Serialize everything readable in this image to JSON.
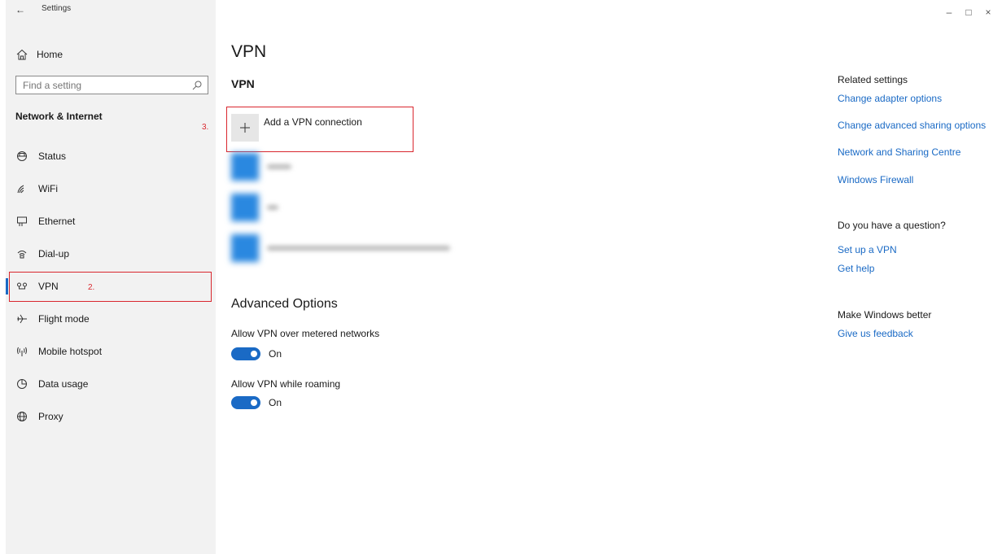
{
  "window": {
    "back_glyph": "←",
    "title": "Settings",
    "minimize_glyph": "–",
    "restore_glyph": "□",
    "close_glyph": "×"
  },
  "sidebar": {
    "home_label": "Home",
    "search_placeholder": "Find a setting",
    "section_title": "Network & Internet",
    "items": [
      {
        "label": "Status",
        "icon": "status-icon"
      },
      {
        "label": "WiFi",
        "icon": "wifi-icon"
      },
      {
        "label": "Ethernet",
        "icon": "ethernet-icon"
      },
      {
        "label": "Dial-up",
        "icon": "dialup-icon"
      },
      {
        "label": "VPN",
        "icon": "vpn-icon",
        "selected": true
      },
      {
        "label": "Flight mode",
        "icon": "airplane-icon"
      },
      {
        "label": "Mobile hotspot",
        "icon": "hotspot-icon"
      },
      {
        "label": "Data usage",
        "icon": "data-usage-icon"
      },
      {
        "label": "Proxy",
        "icon": "globe-icon"
      }
    ]
  },
  "annotations": {
    "vpn_step": "2.",
    "add_step": "3.",
    "color": "#d9272e"
  },
  "main": {
    "title": "VPN",
    "subtitle": "VPN",
    "add_label": "Add a VPN connection",
    "advanced_title": "Advanced Options",
    "options": [
      {
        "label": "Allow VPN over metered networks",
        "state": "On",
        "on": true
      },
      {
        "label": "Allow VPN while roaming",
        "state": "On",
        "on": true
      }
    ]
  },
  "right": {
    "related_heading": "Related settings",
    "related_links": [
      "Change adapter options",
      "Change advanced sharing options",
      "Network and Sharing Centre",
      "Windows Firewall"
    ],
    "question_heading": "Do you have a question?",
    "question_links": [
      "Set up a VPN",
      "Get help"
    ],
    "feedback_heading": "Make Windows better",
    "feedback_link": "Give us feedback"
  },
  "colors": {
    "accent": "#1a6ac5",
    "sidebar_bg": "#f2f2f2",
    "tile_blue": "#2a88e0"
  }
}
